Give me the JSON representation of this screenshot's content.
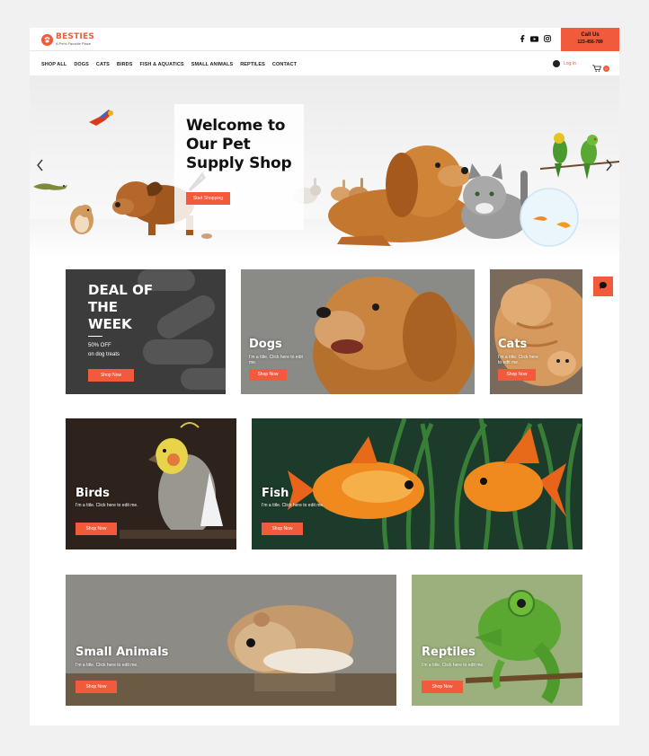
{
  "brand": {
    "name": "BESTIES",
    "tagline": "A Pet's Favorite Place"
  },
  "contact": {
    "title": "Call Us",
    "phone": "123-456-789"
  },
  "nav": [
    "SHOP ALL",
    "DOGS",
    "CATS",
    "BIRDS",
    "FISH & AQUATICS",
    "SMALL ANIMALS",
    "REPTILES",
    "CONTACT"
  ],
  "account": {
    "login_label": "Log In",
    "cart_count": "0"
  },
  "hero": {
    "title": "Welcome to Our Pet Supply Shop",
    "button": "Start Shopping"
  },
  "deal": {
    "title": "DEAL OF THE WEEK",
    "line1": "50% OFF",
    "line2": "on dog treats",
    "button": "Shop Now"
  },
  "tiles": [
    {
      "title": "Dogs",
      "sub": "I'm a title. Click here to edit me.",
      "button": "Shop Now"
    },
    {
      "title": "Cats",
      "sub": "I'm a title. Click here to edit me.",
      "button": "Shop Now"
    },
    {
      "title": "Birds",
      "sub": "I'm a title. Click here to edit me.",
      "button": "Shop Now"
    },
    {
      "title": "Fish",
      "sub": "I'm a title. Click here to edit me.",
      "button": "Shop Now"
    },
    {
      "title": "Small Animals",
      "sub": "I'm a title. Click here to edit me.",
      "button": "Shop Now"
    },
    {
      "title": "Reptiles",
      "sub": "I'm a title. Click here to edit me.",
      "button": "Shop Now"
    }
  ],
  "colors": {
    "accent": "#f15a3a",
    "text": "#222222",
    "background": "#f1f1f2"
  },
  "icons": [
    "paw-logo-icon",
    "facebook-icon",
    "youtube-icon",
    "instagram-icon",
    "user-icon",
    "cart-icon",
    "chevron-left-icon",
    "chevron-right-icon",
    "chat-icon"
  ]
}
